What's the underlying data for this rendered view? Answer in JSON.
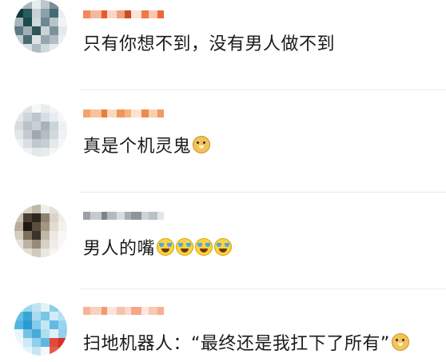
{
  "comments": [
    {
      "text": "只有你想不到，没有男人做不到",
      "emojis": [],
      "avatar_colors": [
        "#d7dde2",
        "#a9b4bd",
        "#e6ecef",
        "#bcc5cc",
        "#7f8c95",
        "#dfe5e8",
        "#0f3b3c",
        "#2a5b5e",
        "#c7d0d6",
        "#8aa0aa",
        "#3f6d73",
        "#e9eef0",
        "#a5b3ba",
        "#1d4a4e",
        "#d0d8dc",
        "#6f8790",
        "#b8c4ca",
        "#f1f4f5",
        "#5c7a82",
        "#9fb0b8",
        "#2e5458",
        "#cbd4d9",
        "#7b929a",
        "#e2e8eb",
        "#c2ccd1",
        "#476a71",
        "#dde3e6",
        "#93a6ae",
        "#b0bec4",
        "#ecf0f2",
        "#eef2f4",
        "#d9e0e3",
        "#aebcc2",
        "#cfd8dc",
        "#e5eaed",
        "#f4f6f7"
      ],
      "name_colors": [
        "#f08a5b",
        "#f6b89a",
        "#e45b2f",
        "#fbd6c5",
        "#f2a07a",
        "#c94b2a",
        "#fbe3d6",
        "#ee7848",
        "#f9c7ae",
        "#e86a3a"
      ],
      "badge_colors": [
        "#f5d050",
        "#f28f3b",
        "#e85a2c",
        "#f7a1a1",
        "#f26d6d",
        "#f5c542",
        "#fbd9a6",
        "#f07a3c",
        "#f4b24a"
      ]
    },
    {
      "text": "真是个机灵鬼",
      "emojis": [
        "doge"
      ],
      "avatar_colors": [
        "#eef1f3",
        "#dfe5e9",
        "#f5f7f8",
        "#e8ecef",
        "#f2f4f6",
        "#fafbfc",
        "#e2e7ea",
        "#cfd6db",
        "#bfc7cd",
        "#d8dee2",
        "#e9edf0",
        "#f7f8f9",
        "#d6dce0",
        "#b9c2c8",
        "#c9d0d5",
        "#a8b2b9",
        "#cdd4d9",
        "#eef1f3",
        "#e1e6e9",
        "#c4ccd2",
        "#9ea9b1",
        "#b4bdc4",
        "#d2d9dd",
        "#f0f3f5",
        "#eef1f3",
        "#d9dfe3",
        "#c0c9cf",
        "#c8cfd4",
        "#e4e9ec",
        "#f6f7f8",
        "#f8f9fa",
        "#eff2f4",
        "#e3e8eb",
        "#e7ebee",
        "#f3f5f7",
        "#fbfcfc"
      ],
      "name_colors": [
        "#f4a36b",
        "#f8c29b",
        "#ea7d3c",
        "#fad9c0",
        "#f0955a",
        "#f6b283",
        "#fbe3cf",
        "#ee8a4b",
        "#f9cfb0",
        "#f09a63"
      ],
      "badge_colors": [
        "#ffffff",
        "#f5a623",
        "#ffffff",
        "#f2a03a",
        "#e8641e",
        "#f3a33b",
        "#ffffff",
        "#f6b04a",
        "#ffffff"
      ]
    },
    {
      "text": "男人的嘴",
      "emojis": [
        "cry",
        "cry",
        "cry",
        "cry"
      ],
      "avatar_colors": [
        "#e9e7e2",
        "#d6d2ca",
        "#bfb8ab",
        "#f1efeb",
        "#e4e0d8",
        "#f7f6f3",
        "#cbc4b6",
        "#4a3f32",
        "#2d2620",
        "#8e8372",
        "#d9d3c8",
        "#efece7",
        "#b8ad9b",
        "#1e1913",
        "#5a4d3e",
        "#a39683",
        "#e1dbd1",
        "#f4f2ee",
        "#d3ccc0",
        "#7d705e",
        "#3b322a",
        "#c2b8a8",
        "#ece8e2",
        "#f8f7f5",
        "#e6e2db",
        "#bdb3a3",
        "#968a78",
        "#d7d0c4",
        "#f0ede9",
        "#f9f8f6",
        "#f4f2ef",
        "#e2ddd5",
        "#d0c9bd",
        "#ebe7e1",
        "#f6f5f2",
        "#fbfaf9"
      ],
      "name_colors": [
        "#9aa0a6",
        "#c7cbcf",
        "#7d848a",
        "#b5babf",
        "#d9dcdf",
        "#a8aeb3",
        "#8f959b",
        "#ced2d5",
        "#bcc1c5",
        "#e3e5e7"
      ],
      "badge_colors": [
        "#6aa6e8",
        "#9cc4f0",
        "#ffffff",
        "#4f93e0",
        "#7fb3ec",
        "#b3d2f4",
        "#ffffff",
        "#ffffff",
        "#ffffff"
      ]
    },
    {
      "text": "扫地机器人：“最终还是我扛下了所有”",
      "emojis": [
        "doge"
      ],
      "avatar_colors": [
        "#d6eef7",
        "#9fd6ee",
        "#bfe3f3",
        "#e3f3fa",
        "#8ccde9",
        "#c8e8f5",
        "#67bde2",
        "#3aa6d8",
        "#a8dbf0",
        "#7ac6e6",
        "#d1ecf7",
        "#b3e0f2",
        "#53b3df",
        "#2b9bd3",
        "#86cbe8",
        "#c2e6f4",
        "#62b9e1",
        "#9bd4ed",
        "#e8f5fb",
        "#74c3e5",
        "#47acda",
        "#b0def1",
        "#def1f9",
        "#93d0eb",
        "#f0f8fc",
        "#cde9f6",
        "#8fcfea",
        "#5fb7e0",
        "#e04a3a",
        "#d92f2a",
        "#f6fbfd",
        "#e6f4fa",
        "#c6e6f5",
        "#f2f9fc",
        "#e75a4a",
        "#de3b32"
      ],
      "name_colors": [
        "#f6b59a",
        "#fad0bf",
        "#f19a78",
        "#fde4d9",
        "#f7c1aa",
        "#fbd9cb",
        "#f3a788",
        "#fce8de",
        "#f8c8b3",
        "#f5b090"
      ],
      "badge_colors": [
        "#f7c98f",
        "#f3b36a",
        "#f9d8ad",
        "#f0a24f",
        "#f6be7d",
        "#fbe1bf",
        "#f5b775",
        "#f8cc97",
        "#fce7cb"
      ]
    }
  ]
}
